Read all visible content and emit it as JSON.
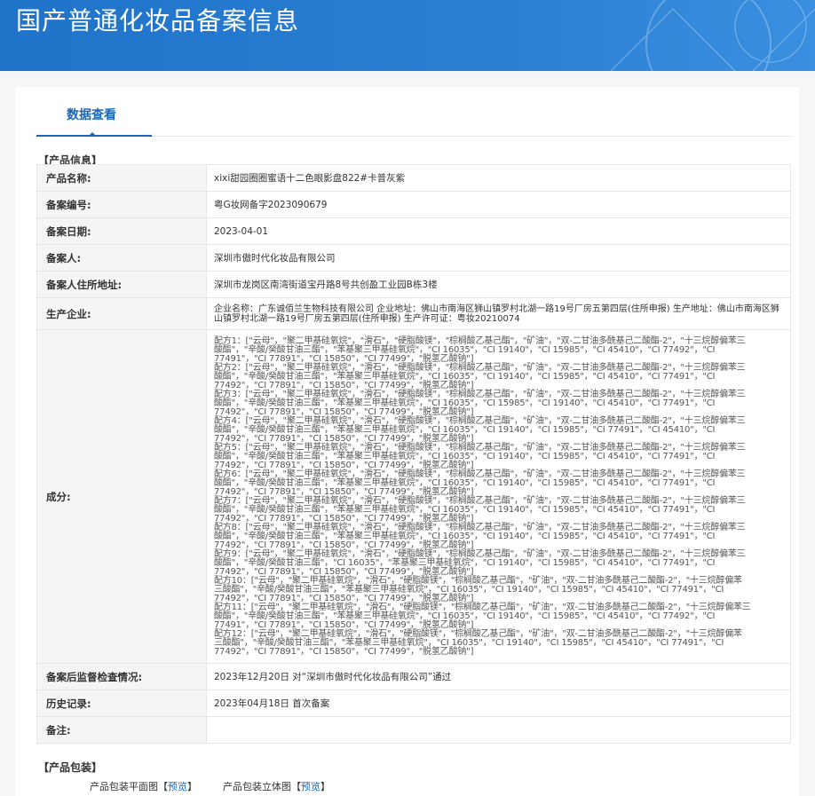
{
  "header": {
    "title": "国产普通化妆品备案信息"
  },
  "tabs": [
    {
      "label": "数据查看"
    }
  ],
  "product_section_title": "【产品信息】",
  "rows": [
    {
      "label": "产品名称:",
      "value": "xixi甜园圈圈蜜语十二色眼影盘822#卡普灰紫"
    },
    {
      "label": "备案编号:",
      "value": "粤G妆网备字2023090679"
    },
    {
      "label": "备案日期:",
      "value": "2023-04-01"
    },
    {
      "label": "备案人:",
      "value": "深圳市傲时代化妆品有限公司"
    },
    {
      "label": "备案人住所地址:",
      "value": "深圳市龙岗区南湾街道宝丹路8号共创盈工业园B栋3楼"
    },
    {
      "label": "生产企业:",
      "value": "企业名称：广东诚佰兰生物科技有限公司 企业地址：佛山市南海区狮山镇罗村北湖一路19号厂房五第四层(住所申报) 生产地址：佛山市南海区狮山镇罗村北湖一路19号厂房五第四层(住所申报) 生产许可证：粤妆20210074"
    },
    {
      "label": "成分:",
      "value": "配方1：[\"云母\"，\"聚二甲基硅氧烷\"，\"滑石\"，\"硬脂酸镁\"，\"棕榈酸乙基己酯\"，\"矿油\"，\"双-二甘油多酰基己二酸酯-2\"，\"十三烷醇偏苯三酸酯\"，\"辛酸/癸酸甘油三酯\"，\"苯基聚三甲基硅氧烷\"，\"CI 16035\"，\"CI 19140\"，\"CI 15985\"，\"CI 45410\"，\"CI 77492\"，\"CI 77491\"，\"CI 77891\"，\"CI 15850\"，\"CI 77499\"，\"脱氢乙酸钠\"] 配方2：[\"云母\"，\"聚二甲基硅氧烷\"，\"滑石\"，\"硬脂酸镁\"，\"棕榈酸乙基己酯\"，\"矿油\"，\"双-二甘油多酰基己二酸酯-2\"，\"十三烷醇偏苯三酸酯\"，\"辛酸/癸酸甘油三酯\"，\"苯基聚三甲基硅氧烷\"，\"CI 16035\"，\"CI 19140\"，\"CI 15985\"，\"CI 45410\"，\"CI 77491\"，\"CI 77492\"，\"CI 77891\"，\"CI 15850\"，\"CI 77499\"，\"脱氢乙酸钠\"] 配方3：[\"云母\"，\"聚二甲基硅氧烷\"，\"滑石\"，\"硬脂酸镁\"，\"棕榈酸乙基己酯\"，\"矿油\"，\"双-二甘油多酰基己二酸酯-2\"，\"十三烷醇偏苯三酸酯\"，\"辛酸/癸酸甘油三酯\"，\"苯基聚三甲基硅氧烷\"，\"CI 16035\"，\"CI 15985\"，\"CI 19140\"，\"CI 45410\"，\"CI 77491\"，\"CI 77492\"，\"CI 77891\"，\"CI 15850\"，\"CI 77499\"，\"脱氢乙酸钠\"] 配方4：[\"云母\"，\"聚二甲基硅氧烷\"，\"滑石\"，\"硬脂酸镁\"，\"棕榈酸乙基己酯\"，\"矿油\"，\"双-二甘油多酰基己二酸酯-2\"，\"十三烷醇偏苯三酸酯\"，\"辛酸/癸酸甘油三酯\"，\"苯基聚三甲基硅氧烷\"，\"CI 16035\"，\"CI 19140\"，\"CI 15985\"，\"CI 77491\"，\"CI 45410\"，\"CI 77492\"，\"CI 77891\"，\"CI 15850\"，\"CI 77499\"，\"脱氢乙酸钠\"] 配方5：[\"云母\"，\"聚二甲基硅氧烷\"，\"滑石\"，\"硬脂酸镁\"，\"棕榈酸乙基己酯\"，\"矿油\"，\"双-二甘油多酰基己二酸酯-2\"，\"十三烷醇偏苯三酸酯\"，\"辛酸/癸酸甘油三酯\"，\"苯基聚三甲基硅氧烷\"，\"CI 16035\"，\"CI 19140\"，\"CI 15985\"，\"CI 45410\"，\"CI 77491\"，\"CI 77492\"，\"CI 77891\"，\"CI 15850\"，\"CI 77499\"，\"脱氢乙酸钠\"] 配方6：[\"云母\"，\"聚二甲基硅氧烷\"，\"滑石\"，\"硬脂酸镁\"，\"棕榈酸乙基己酯\"，\"矿油\"，\"双-二甘油多酰基己二酸酯-2\"，\"十三烷醇偏苯三酸酯\"，\"辛酸/癸酸甘油三酯\"，\"苯基聚三甲基硅氧烷\"，\"CI 16035\"，\"CI 19140\"，\"CI 15985\"，\"CI 45410\"，\"CI 77491\"，\"CI 77492\"，\"CI 77891\"，\"CI 15850\"，\"CI 77499\"，\"脱氢乙酸钠\"] 配方7：[\"云母\"，\"聚二甲基硅氧烷\"，\"滑石\"，\"硬脂酸镁\"，\"棕榈酸乙基己酯\"，\"矿油\"，\"双-二甘油多酰基己二酸酯-2\"，\"十三烷醇偏苯三酸酯\"，\"辛酸/癸酸甘油三酯\"，\"苯基聚三甲基硅氧烷\"，\"CI 16035\"，\"CI 19140\"，\"CI 15985\"，\"CI 45410\"，\"CI 77491\"，\"CI 77492\"，\"CI 77891\"，\"CI 15850\"，\"CI 77499\"，\"脱氢乙酸钠\"] 配方8：[\"云母\"，\"聚二甲基硅氧烷\"，\"滑石\"，\"硬脂酸镁\"，\"棕榈酸乙基己酯\"，\"矿油\"，\"双-二甘油多酰基己二酸酯-2\"，\"十三烷醇偏苯三酸酯\"，\"辛酸/癸酸甘油三酯\"，\"苯基聚三甲基硅氧烷\"，\"CI 16035\"，\"CI 19140\"，\"CI 15985\"，\"CI 45410\"，\"CI 77491\"，\"CI 77492\"，\"CI 77891\"，\"CI 15850\"，\"CI 77499\"，\"脱氢乙酸钠\"] 配方9：[\"云母\"，\"聚二甲基硅氧烷\"，\"滑石\"，\"硬脂酸镁\"，\"棕榈酸乙基己酯\"，\"矿油\"，\"双-二甘油多酰基己二酸酯-2\"，\"十三烷醇偏苯三酸酯\"，\"辛酸/癸酸甘油三酯\"，\"CI 16035\"，\"苯基聚三甲基硅氧烷\"，\"CI 19140\"，\"CI 15985\"，\"CI 45410\"，\"CI 77491\"，\"CI 77492\"，\"CI 77891\"，\"CI 15850\"，\"CI 77499\"，\"脱氢乙酸钠\"] 配方10：[\"云母\"，\"聚二甲基硅氧烷\"，\"滑石\"，\"硬脂酸镁\"，\"棕榈酸乙基己酯\"，\"矿油\"，\"双-二甘油多酰基己二酸酯-2\"，\"十三烷醇偏苯三酸酯\"，\"辛酸/癸酸甘油三酯\"，\"苯基聚三甲基硅氧烷\"，\"CI 16035\"，\"CI 19140\"，\"CI 15985\"，\"CI 45410\"，\"CI 77491\"，\"CI 77492\"，\"CI 77891\"，\"CI 15850\"，\"CI 77499\"，\"脱氢乙酸钠\"] 配方11：[\"云母\"，\"聚二甲基硅氧烷\"，\"滑石\"，\"硬脂酸镁\"，\"棕榈酸乙基己酯\"，\"矿油\"，\"双-二甘油多酰基己二酸酯-2\"，\"十三烷醇偏苯三酸酯\"，\"辛酸/癸酸甘油三酯\"，\"苯基聚三甲基硅氧烷\"，\"CI 16035\"，\"CI 19140\"，\"CI 15985\"，\"CI 45410\"，\"CI 77492\"，\"CI 77491\"，\"CI 77891\"，\"CI 15850\"，\"CI 77499\"，\"脱氢乙酸钠\"] 配方12：[\"云母\"，\"聚二甲基硅氧烷\"，\"滑石\"，\"硬脂酸镁\"，\"棕榈酸乙基己酯\"，\"矿油\"，\"双-二甘油多酰基己二酸酯-2\"，\"十三烷醇偏苯三酸酯\"，\"辛酸/癸酸甘油三酯\"，\"苯基聚三甲基硅氧烷\"，\"CI 16035\"，\"CI 19140\"，\"CI 15985\"，\"CI 45410\"，\"CI 77491\"，\"CI 77492\"，\"CI 77891\"，\"CI 15850\"，\"CI 77499\"，\"脱氢乙酸钠\"]"
    },
    {
      "label": "备案后监督检查情况:",
      "value": "2023年12月20日 对“深圳市傲时代化妆品有限公司”通过"
    },
    {
      "label": "历史记录:",
      "value": "2023年04月18日 首次备案"
    },
    {
      "label": "备注:",
      "value": ""
    }
  ],
  "ingredients_lines": [
    "配方1：[\"云母\"，\"聚二甲基硅氧烷\"，\"滑石\"，\"硬脂酸镁\"，\"棕榈酸乙基己酯\"，\"矿油\"，\"双-二甘油多酰基己二酸酯-2\"，\"十三烷醇偏苯三",
    "酸酯\"，\"辛酸/癸酸甘油三酯\"，\"苯基聚三甲基硅氧烷\"，\"CI 16035\"，\"CI 19140\"，\"CI 15985\"，\"CI 45410\"，\"CI 77492\"，\"CI",
    "77491\"，\"CI 77891\"，\"CI 15850\"，\"CI 77499\"，\"脱氢乙酸钠\"]",
    "配方2：[\"云母\"，\"聚二甲基硅氧烷\"，\"滑石\"，\"硬脂酸镁\"，\"棕榈酸乙基己酯\"，\"矿油\"，\"双-二甘油多酰基己二酸酯-2\"，\"十三烷醇偏苯三",
    "酸酯\"，\"辛酸/癸酸甘油三酯\"，\"苯基聚三甲基硅氧烷\"，\"CI 16035\"，\"CI 19140\"，\"CI 15985\"，\"CI 45410\"，\"CI 77491\"，\"CI",
    "77492\"，\"CI 77891\"，\"CI 15850\"，\"CI 77499\"，\"脱氢乙酸钠\"]",
    "配方3：[\"云母\"，\"聚二甲基硅氧烷\"，\"滑石\"，\"硬脂酸镁\"，\"棕榈酸乙基己酯\"，\"矿油\"，\"双-二甘油多酰基己二酸酯-2\"，\"十三烷醇偏苯三",
    "酸酯\"，\"辛酸/癸酸甘油三酯\"，\"苯基聚三甲基硅氧烷\"，\"CI 16035\"，\"CI 15985\"，\"CI 19140\"，\"CI 45410\"，\"CI 77491\"，\"CI",
    "77492\"，\"CI 77891\"，\"CI 15850\"，\"CI 77499\"，\"脱氢乙酸钠\"]",
    "配方4：[\"云母\"，\"聚二甲基硅氧烷\"，\"滑石\"，\"硬脂酸镁\"，\"棕榈酸乙基己酯\"，\"矿油\"，\"双-二甘油多酰基己二酸酯-2\"，\"十三烷醇偏苯三",
    "酸酯\"，\"辛酸/癸酸甘油三酯\"，\"苯基聚三甲基硅氧烷\"，\"CI 16035\"，\"CI 19140\"，\"CI 15985\"，\"CI 77491\"，\"CI 45410\"，\"CI",
    "77492\"，\"CI 77891\"，\"CI 15850\"，\"CI 77499\"，\"脱氢乙酸钠\"]",
    "配方5：[\"云母\"，\"聚二甲基硅氧烷\"，\"滑石\"，\"硬脂酸镁\"，\"棕榈酸乙基己酯\"，\"矿油\"，\"双-二甘油多酰基己二酸酯-2\"，\"十三烷醇偏苯三",
    "酸酯\"，\"辛酸/癸酸甘油三酯\"，\"苯基聚三甲基硅氧烷\"，\"CI 16035\"，\"CI 19140\"，\"CI 15985\"，\"CI 45410\"，\"CI 77491\"，\"CI",
    "77492\"，\"CI 77891\"，\"CI 15850\"，\"CI 77499\"，\"脱氢乙酸钠\"]",
    "配方6：[\"云母\"，\"聚二甲基硅氧烷\"，\"滑石\"，\"硬脂酸镁\"，\"棕榈酸乙基己酯\"，\"矿油\"，\"双-二甘油多酰基己二酸酯-2\"，\"十三烷醇偏苯三",
    "酸酯\"，\"辛酸/癸酸甘油三酯\"，\"苯基聚三甲基硅氧烷\"，\"CI 16035\"，\"CI 19140\"，\"CI 15985\"，\"CI 45410\"，\"CI 77491\"，\"CI",
    "77492\"，\"CI 77891\"，\"CI 15850\"，\"CI 77499\"，\"脱氢乙酸钠\"]",
    "配方7：[\"云母\"，\"聚二甲基硅氧烷\"，\"滑石\"，\"硬脂酸镁\"，\"棕榈酸乙基己酯\"，\"矿油\"，\"双-二甘油多酰基己二酸酯-2\"，\"十三烷醇偏苯三",
    "酸酯\"，\"辛酸/癸酸甘油三酯\"，\"苯基聚三甲基硅氧烷\"，\"CI 16035\"，\"CI 19140\"，\"CI 15985\"，\"CI 45410\"，\"CI 77491\"，\"CI",
    "77492\"，\"CI 77891\"，\"CI 15850\"，\"CI 77499\"，\"脱氢乙酸钠\"]",
    "配方8：[\"云母\"，\"聚二甲基硅氧烷\"，\"滑石\"，\"硬脂酸镁\"，\"棕榈酸乙基己酯\"，\"矿油\"，\"双-二甘油多酰基己二酸酯-2\"，\"十三烷醇偏苯三",
    "酸酯\"，\"辛酸/癸酸甘油三酯\"，\"苯基聚三甲基硅氧烷\"，\"CI 16035\"，\"CI 19140\"，\"CI 15985\"，\"CI 45410\"，\"CI 77491\"，\"CI",
    "77492\"，\"CI 77891\"，\"CI 15850\"，\"CI 77499\"，\"脱氢乙酸钠\"]",
    "配方9：[\"云母\"，\"聚二甲基硅氧烷\"，\"滑石\"，\"硬脂酸镁\"，\"棕榈酸乙基己酯\"，\"矿油\"，\"双-二甘油多酰基己二酸酯-2\"，\"十三烷醇偏苯三",
    "酸酯\"，\"辛酸/癸酸甘油三酯\"，\"CI 16035\"，\"苯基聚三甲基硅氧烷\"，\"CI 19140\"，\"CI 15985\"，\"CI 45410\"，\"CI 77491\"，\"CI",
    "77492\"，\"CI 77891\"，\"CI 15850\"，\"CI 77499\"，\"脱氢乙酸钠\"]",
    "配方10：[\"云母\"，\"聚二甲基硅氧烷\"，\"滑石\"，\"硬脂酸镁\"，\"棕榈酸乙基己酯\"，\"矿油\"，\"双-二甘油多酰基己二酸酯-2\"，\"十三烷醇偏苯",
    "三酸酯\"，\"辛酸/癸酸甘油三酯\"，\"苯基聚三甲基硅氧烷\"，\"CI 16035\"，\"CI 19140\"，\"CI 15985\"，\"CI 45410\"，\"CI 77491\"，\"CI",
    "77492\"，\"CI 77891\"，\"CI 15850\"，\"CI 77499\"，\"脱氢乙酸钠\"]",
    "配方11：[\"云母\"，\"聚二甲基硅氧烷\"，\"滑石\"，\"硬脂酸镁\"，\"棕榈酸乙基己酯\"，\"矿油\"，\"双-二甘油多酰基己二酸酯-2\"，\"十三烷醇偏苯三",
    "酸酯\"，\"辛酸/癸酸甘油三酯\"，\"苯基聚三甲基硅氧烷\"，\"CI 16035\"，\"CI 19140\"，\"CI 15985\"，\"CI 45410\"，\"CI 77492\"，\"CI",
    "77491\"，\"CI 77891\"，\"CI 15850\"，\"CI 77499\"，\"脱氢乙酸钠\"]",
    "配方12：[\"云母\"，\"聚二甲基硅氧烷\"，\"滑石\"，\"硬脂酸镁\"，\"棕榈酸乙基己酯\"，\"矿油\"，\"双-二甘油多酰基己二酸酯-2\"，\"十三烷醇偏苯",
    "三酸酯\"，\"辛酸/癸酸甘油三酯\"，\"苯基聚三甲基硅氧烷\"，\"CI 16035\"，\"CI 19140\"，\"CI 15985\"，\"CI 45410\"，\"CI 77491\"，\"CI",
    "77492\"，\"CI 77891\"，\"CI 15850\"，\"CI 77499\"，\"脱氢乙酸钠\"]"
  ],
  "packaging": {
    "section_title": "【产品包装】",
    "flat_label": "产品包装平面图",
    "stereo_label": "产品包装立体图",
    "preview_link": "预览",
    "bracket_open": "【",
    "bracket_close": "】"
  },
  "colors": {
    "header_blue": "#1f73c9",
    "accent": "#1b66b3",
    "table_border": "#a9c6e8"
  }
}
